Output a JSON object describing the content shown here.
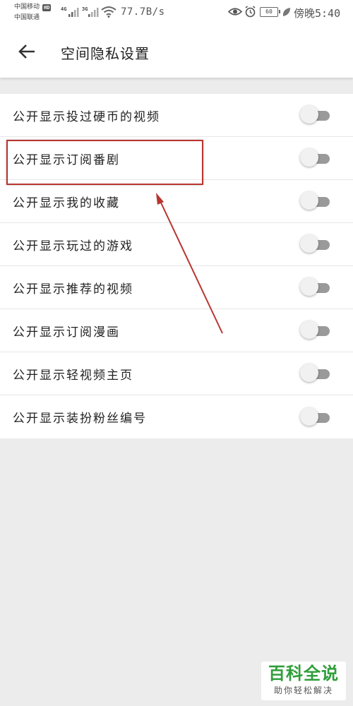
{
  "status_bar": {
    "carrier_1": "中国移动",
    "carrier_1_badge": "HD",
    "carrier_2": "中国联通",
    "network_1": "4G",
    "network_2": "3G",
    "net_speed": "77.7B/s",
    "battery_level": "60",
    "time": "傍晚5:40",
    "icons": [
      "signal-icon",
      "wifi-icon",
      "eye-icon",
      "alarm-icon",
      "battery-icon",
      "leaf-icon"
    ]
  },
  "header": {
    "title": "空间隐私设置",
    "back_icon": "arrow-left-icon"
  },
  "settings": {
    "items": [
      {
        "label": "公开显示投过硬币的视频",
        "enabled": false
      },
      {
        "label": "公开显示订阅番剧",
        "enabled": false
      },
      {
        "label": "公开显示我的收藏",
        "enabled": false
      },
      {
        "label": "公开显示玩过的游戏",
        "enabled": false
      },
      {
        "label": "公开显示推荐的视频",
        "enabled": false
      },
      {
        "label": "公开显示订阅漫画",
        "enabled": false
      },
      {
        "label": "公开显示轻视频主页",
        "enabled": false
      },
      {
        "label": "公开显示装扮粉丝编号",
        "enabled": false
      }
    ]
  },
  "annotation": {
    "highlight_color": "#b8352f"
  },
  "watermark": {
    "main": "百科全说",
    "sub": "助你轻松解决"
  },
  "colors": {
    "background": "#ececec",
    "toggle_track_off": "#9a9a9a",
    "toggle_knob": "#f1f1f1",
    "watermark_green": "#2f9e3a"
  }
}
